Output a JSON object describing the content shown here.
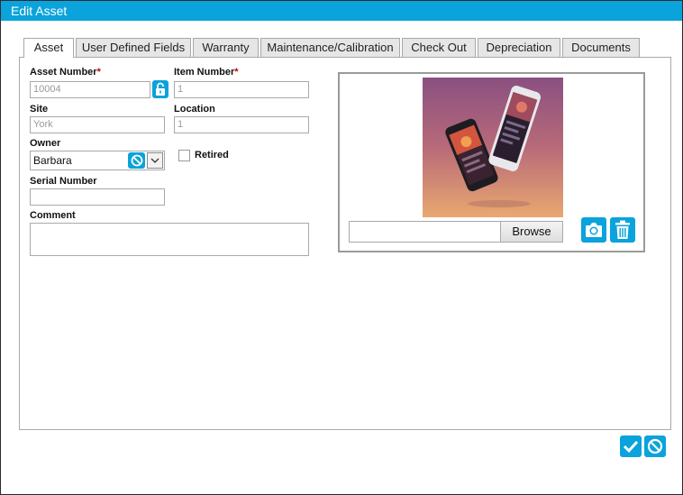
{
  "window": {
    "title": "Edit Asset"
  },
  "tabs": [
    {
      "label": "Asset",
      "active": true
    },
    {
      "label": "User Defined Fields",
      "active": false
    },
    {
      "label": "Warranty",
      "active": false
    },
    {
      "label": "Maintenance/Calibration",
      "active": false
    },
    {
      "label": "Check Out",
      "active": false
    },
    {
      "label": "Depreciation",
      "active": false
    },
    {
      "label": "Documents",
      "active": false
    }
  ],
  "form": {
    "asset_number": {
      "label": "Asset Number",
      "required_mark": "*",
      "value": "10004"
    },
    "item_number": {
      "label": "Item Number",
      "required_mark": "*",
      "value": "1"
    },
    "site": {
      "label": "Site",
      "value": "York"
    },
    "location": {
      "label": "Location",
      "value": "1"
    },
    "owner": {
      "label": "Owner",
      "value": "Barbara"
    },
    "retired": {
      "label": "Retired",
      "checked": false
    },
    "serial_number": {
      "label": "Serial Number",
      "value": ""
    },
    "comment": {
      "label": "Comment",
      "value": ""
    }
  },
  "photo": {
    "browse_label": "Browse",
    "file_value": ""
  },
  "icons": {
    "lock": "lock-open-icon",
    "clear_owner": "prohibit-icon",
    "dropdown": "chevron-down-icon",
    "camera": "camera-icon",
    "delete": "trash-icon",
    "confirm": "check-icon",
    "cancel": "prohibit-icon"
  },
  "colors": {
    "accent": "#0aa3db",
    "required": "#cc0000"
  }
}
